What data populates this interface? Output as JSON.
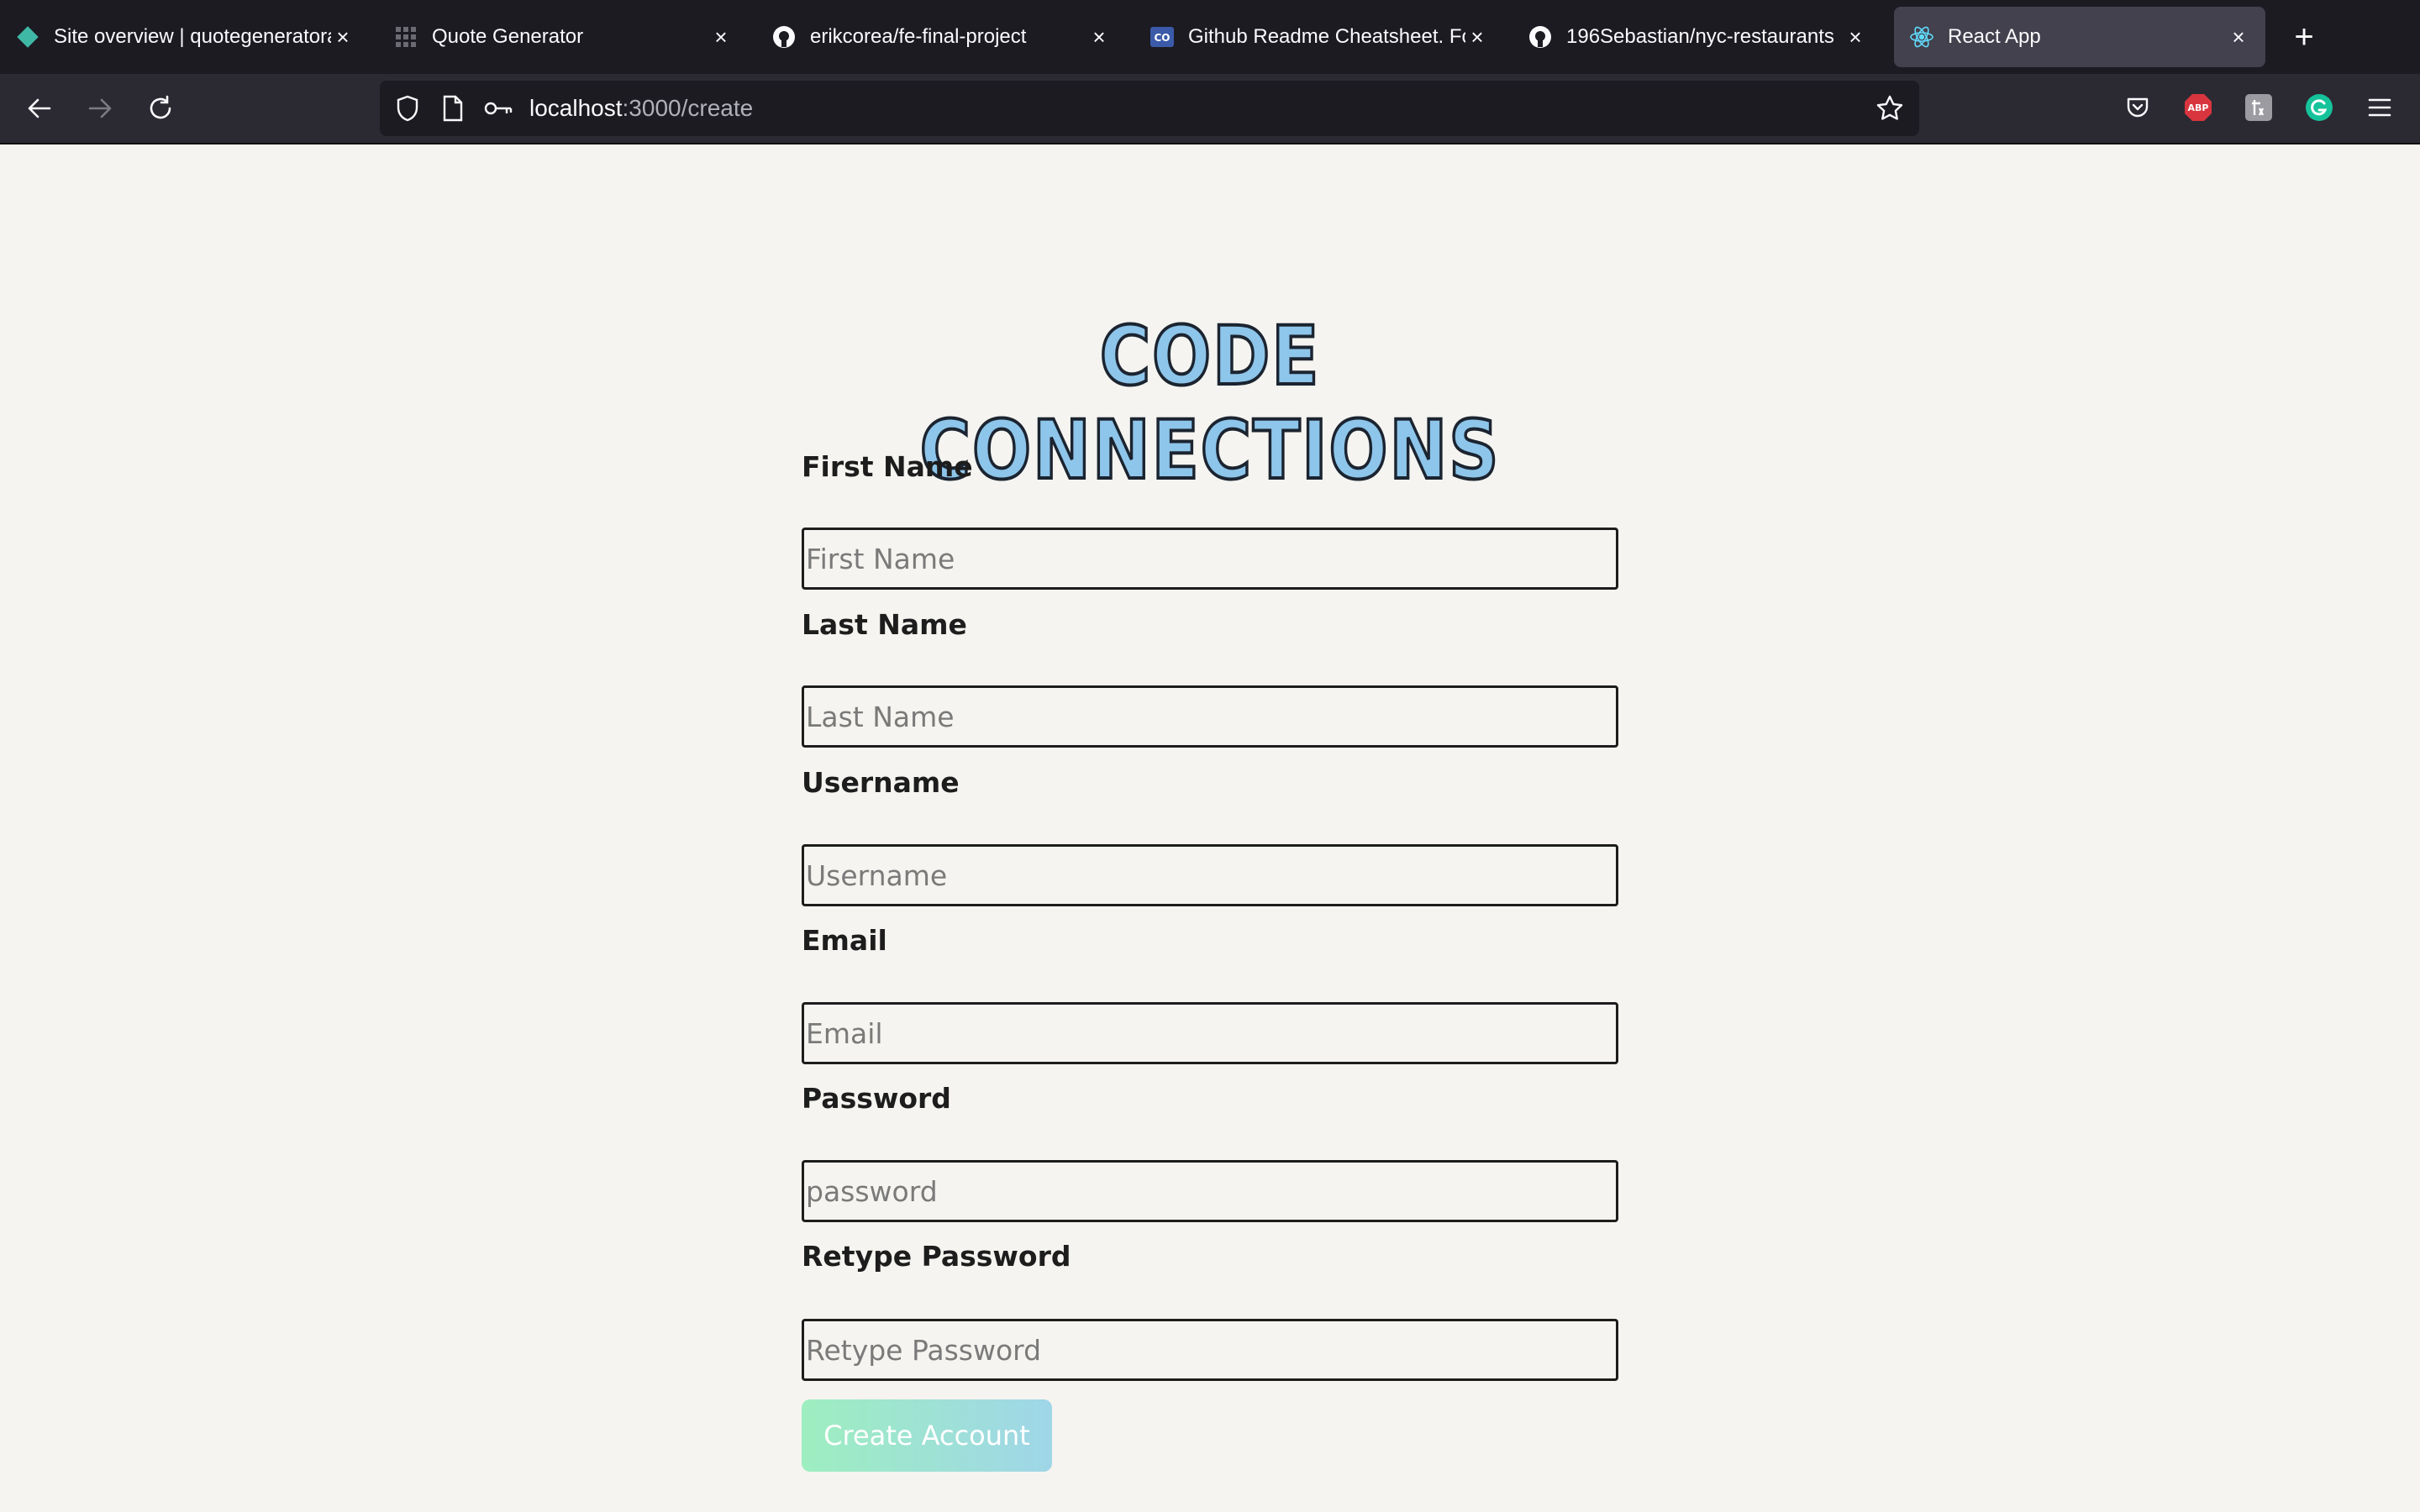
{
  "tabs": [
    {
      "title": "Site overview | quotegeneratora",
      "icon": "netlify-icon"
    },
    {
      "title": "Quote Generator",
      "icon": "grid-icon"
    },
    {
      "title": "erikcorea/fe-final-project",
      "icon": "github-icon"
    },
    {
      "title": "Github Readme Cheatsheet. For",
      "icon": "codementor-icon"
    },
    {
      "title": "196Sebastian/nyc-restaurants",
      "icon": "github-icon"
    },
    {
      "title": "React App",
      "icon": "react-icon",
      "active": true
    }
  ],
  "tab_close_glyph": "×",
  "new_tab_glyph": "+",
  "url": {
    "host": "localhost",
    "path": ":3000/create"
  },
  "extensions": {
    "abp_label": "ABP"
  },
  "page": {
    "logo_text": "CODE CONNECTIONS",
    "fields": [
      {
        "label": "First Name",
        "placeholder": "First Name"
      },
      {
        "label": "Last Name",
        "placeholder": "Last Name"
      },
      {
        "label": "Username",
        "placeholder": "Username"
      },
      {
        "label": "Email",
        "placeholder": "Email"
      },
      {
        "label": "Password",
        "placeholder": "password"
      },
      {
        "label": "Retype Password",
        "placeholder": "Retype Password"
      }
    ],
    "submit_label": "Create Account"
  },
  "colors": {
    "page_bg": "#f5f4f0",
    "logo_fill": "#8ec5ea",
    "button_gradient_start": "#9eeec0",
    "button_gradient_end": "#9fd6e8"
  }
}
